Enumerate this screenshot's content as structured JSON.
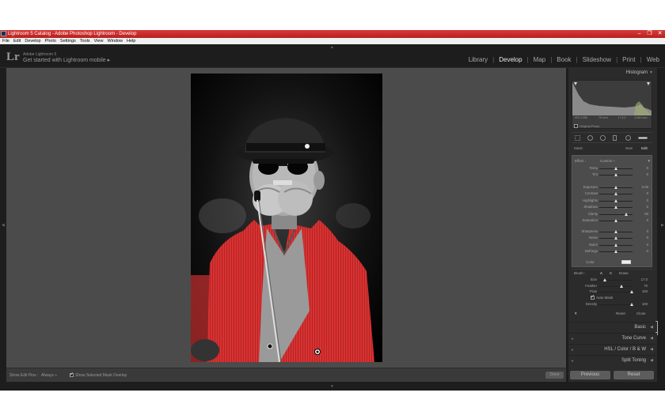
{
  "window": {
    "title": "Lightroom 5 Catalog - Adobe Photoshop Lightroom - Develop",
    "controls": [
      "–",
      "❐",
      "✕"
    ]
  },
  "menu": [
    "File",
    "Edit",
    "Develop",
    "Photo",
    "Settings",
    "Tools",
    "View",
    "Window",
    "Help"
  ],
  "identity": {
    "logo": "Lr",
    "product": "Adobe Lightroom 5",
    "tagline": "Get started with Lightroom mobile ▸"
  },
  "modules": [
    {
      "label": "Library",
      "active": false
    },
    {
      "label": "Develop",
      "active": true
    },
    {
      "label": "Map",
      "active": false
    },
    {
      "label": "Book",
      "active": false
    },
    {
      "label": "Slideshow",
      "active": false
    },
    {
      "label": "Print",
      "active": false
    },
    {
      "label": "Web",
      "active": false
    }
  ],
  "toolbar": {
    "show_edit_pins_label": "Show Edit Pins :",
    "show_edit_pins_value": "Always ÷",
    "overlay_label": "Show Selected Mask Overlay",
    "overlay_checked": true,
    "done_label": "Done"
  },
  "panel": {
    "histogram_title": "Histogram",
    "histogram_info": [
      "ISO 1250",
      "70 mm",
      "f / 3.2",
      "1/160 sec"
    ],
    "original_photo_label": "Original Photo",
    "mask": {
      "label": "Mask :",
      "new": "New",
      "edit": "Edit"
    },
    "effect": {
      "label": "Effect :",
      "value": "Custom ÷"
    },
    "sliders_group1": [
      {
        "label": "Temp",
        "value": "0",
        "pos": 0.5
      },
      {
        "label": "Tint",
        "value": "0",
        "pos": 0.5
      }
    ],
    "sliders_group2": [
      {
        "label": "Exposure",
        "value": "0.00",
        "pos": 0.5
      },
      {
        "label": "Contrast",
        "value": "0",
        "pos": 0.5
      },
      {
        "label": "Highlights",
        "value": "0",
        "pos": 0.5
      },
      {
        "label": "Shadows",
        "value": "0",
        "pos": 0.5
      },
      {
        "label": "Clarity",
        "value": "60",
        "pos": 0.8
      },
      {
        "label": "Saturation",
        "value": "0",
        "pos": 0.5
      }
    ],
    "sliders_group3": [
      {
        "label": "Sharpness",
        "value": "0",
        "pos": 0.5
      },
      {
        "label": "Noise",
        "value": "0",
        "pos": 0.5
      },
      {
        "label": "Moiré",
        "value": "0",
        "pos": 0.5
      },
      {
        "label": "Defringe",
        "value": "0",
        "pos": 0.5
      }
    ],
    "color_label": "Color",
    "brush": {
      "label": "Brush :",
      "a": "A",
      "b": "B",
      "erase": "Erase",
      "size": {
        "label": "Size",
        "value": "17.0",
        "pos": 0.2
      },
      "feather": {
        "label": "Feather",
        "value": "70",
        "pos": 0.7
      },
      "flow": {
        "label": "Flow",
        "value": "100",
        "pos": 1.0
      },
      "auto_mask_label": "Auto Mask",
      "auto_mask_checked": true,
      "density": {
        "label": "Density",
        "value": "100",
        "pos": 1.0
      }
    },
    "reset_label": "Reset",
    "close_label": "Close",
    "sections": [
      {
        "label": "Basic"
      },
      {
        "label": "Tone Curve"
      },
      {
        "label": "HSL  /  Color  /  B & W"
      },
      {
        "label": "Split Toning"
      }
    ],
    "previous_label": "Previous",
    "reset_button_label": "Reset"
  },
  "colors": {
    "mask_overlay": "#e02a2a",
    "panel_bg": "#2b2b2b",
    "canvas_bg": "#4b4b4b",
    "titlebar": "#c82828"
  }
}
